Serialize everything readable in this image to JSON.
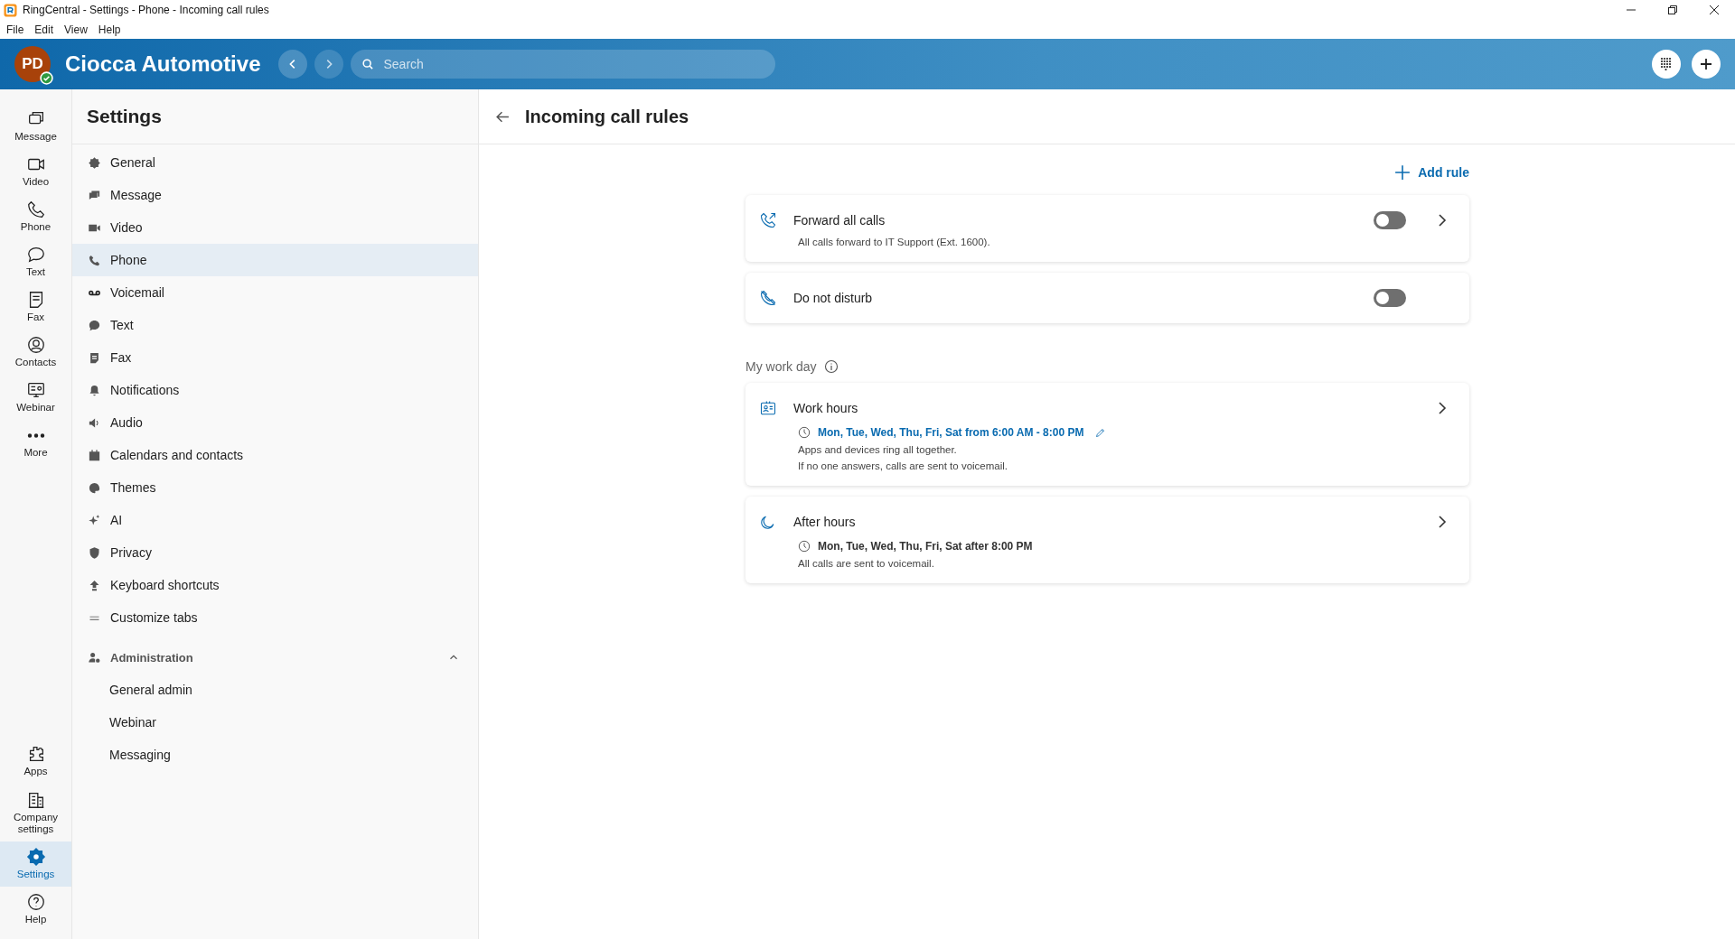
{
  "window": {
    "title": "RingCentral - Settings - Phone - Incoming call rules",
    "menu": [
      "File",
      "Edit",
      "View",
      "Help"
    ]
  },
  "header": {
    "avatar": "PD",
    "org": "Ciocca Automotive",
    "search": {
      "placeholder": "Search"
    }
  },
  "rail": {
    "top": [
      {
        "label": "Message",
        "selected": false
      },
      {
        "label": "Video",
        "selected": false
      },
      {
        "label": "Phone",
        "selected": false
      },
      {
        "label": "Text",
        "selected": false
      },
      {
        "label": "Fax",
        "selected": false
      },
      {
        "label": "Contacts",
        "selected": false
      },
      {
        "label": "Webinar",
        "selected": false
      },
      {
        "label": "More",
        "selected": false
      }
    ],
    "bottom": [
      {
        "label": "Apps",
        "selected": false
      },
      {
        "label": "Company settings",
        "selected": false
      },
      {
        "label": "Settings",
        "selected": true
      },
      {
        "label": "Help",
        "selected": false
      }
    ]
  },
  "sidebar": {
    "title": "Settings",
    "items": [
      {
        "label": "General",
        "selected": false
      },
      {
        "label": "Message",
        "selected": false
      },
      {
        "label": "Video",
        "selected": false
      },
      {
        "label": "Phone",
        "selected": true
      },
      {
        "label": "Voicemail",
        "selected": false
      },
      {
        "label": "Text",
        "selected": false
      },
      {
        "label": "Fax",
        "selected": false
      },
      {
        "label": "Notifications",
        "selected": false
      },
      {
        "label": "Audio",
        "selected": false
      },
      {
        "label": "Calendars and contacts",
        "selected": false
      },
      {
        "label": "Themes",
        "selected": false
      },
      {
        "label": "AI",
        "selected": false
      },
      {
        "label": "Privacy",
        "selected": false
      },
      {
        "label": "Keyboard shortcuts",
        "selected": false
      },
      {
        "label": "Customize tabs",
        "selected": false
      }
    ],
    "group": {
      "label": "Administration",
      "expanded": true,
      "children": [
        {
          "label": "General admin",
          "selected": false
        },
        {
          "label": "Webinar",
          "selected": false
        },
        {
          "label": "Messaging",
          "selected": false
        }
      ]
    }
  },
  "page": {
    "title": "Incoming call rules",
    "add_rule": "Add rule",
    "rules": [
      {
        "title": "Forward all calls",
        "description": "All calls forward to IT Support (Ext. 1600).",
        "on": false,
        "has_details": true
      },
      {
        "title": "Do not disturb",
        "on": false,
        "has_details": false
      }
    ],
    "section": "My work day",
    "schedules": [
      {
        "title": "Work hours",
        "when": "Mon, Tue, Wed, Thu, Fri, Sat from 6:00 AM - 8:00 PM",
        "editable": true,
        "notes": [
          "Apps and devices ring all together.",
          "If no one answers, calls are sent to voicemail."
        ]
      },
      {
        "title": "After hours",
        "when": "Mon, Tue, Wed, Thu, Fri, Sat after 8:00 PM",
        "editable": false,
        "notes": [
          "All calls are sent to voicemail."
        ]
      }
    ]
  }
}
